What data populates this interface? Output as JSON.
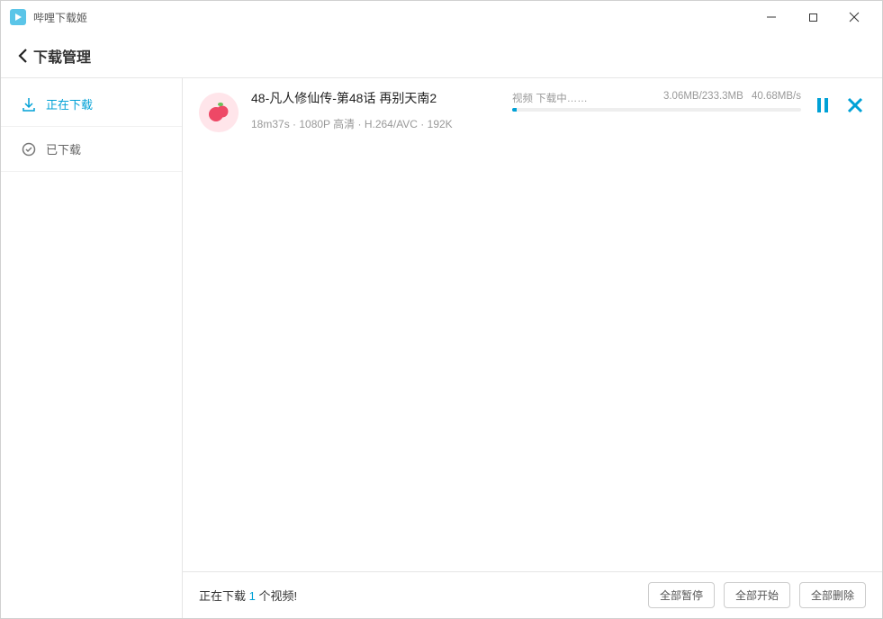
{
  "app": {
    "title": "哔哩下载姬"
  },
  "header": {
    "page_title": "下载管理"
  },
  "sidebar": {
    "items": [
      {
        "label": "正在下载",
        "active": true
      },
      {
        "label": "已下载",
        "active": false
      }
    ]
  },
  "downloads": [
    {
      "title": "48-凡人修仙传-第48话 再别天南2",
      "meta": "18m37s · 1080P 高清 · H.264/AVC · 192K",
      "status_label": "视频 下载中……",
      "progress_text": "3.06MB/233.3MB",
      "speed": "40.68MB/s",
      "percent": 1.5
    }
  ],
  "footer": {
    "status_prefix": "正在下载 ",
    "count": "1",
    "status_suffix": " 个视频!",
    "pause_all": "全部暂停",
    "start_all": "全部开始",
    "delete_all": "全部删除"
  },
  "colors": {
    "accent": "#00a1d6",
    "pink": "#ee4866"
  }
}
